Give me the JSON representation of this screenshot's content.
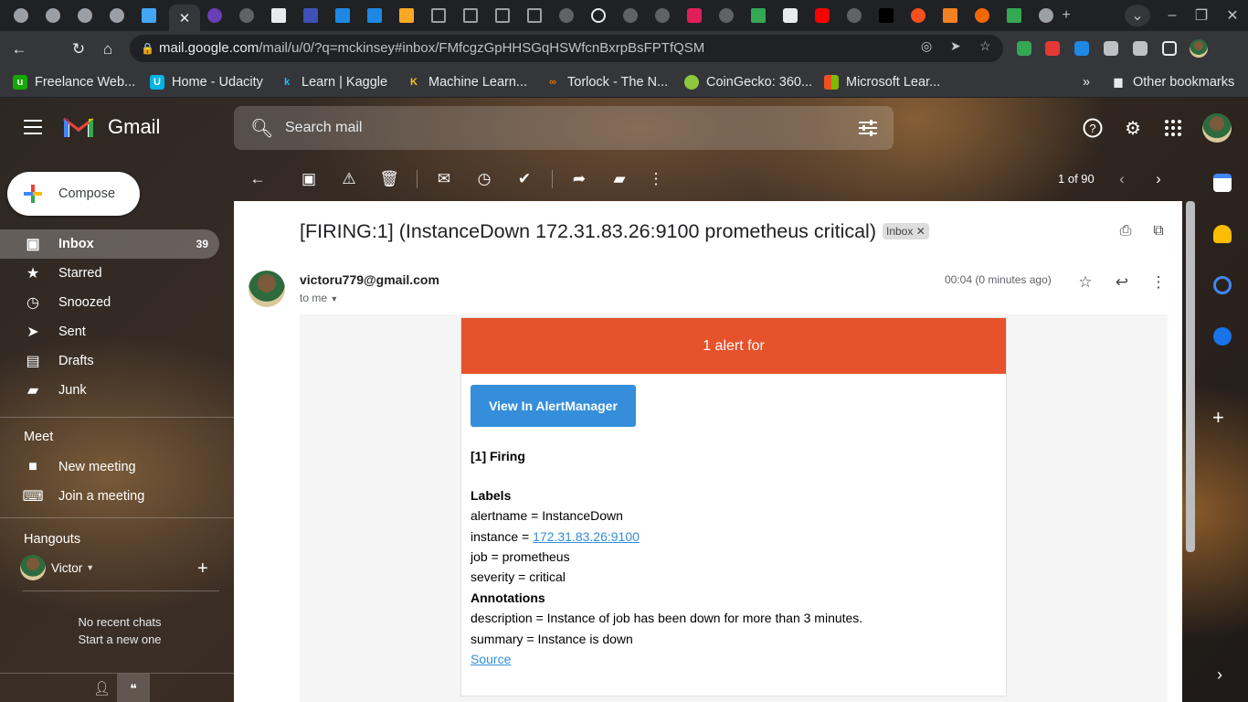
{
  "browser": {
    "address_host": "mail.google.com",
    "address_path": "/mail/u/0/?q=mckinsey#inbox/FMfcgzGpHHSGqHSWfcnBxrpBsFPTfQSM",
    "bookmarks": [
      {
        "label": "Freelance Web...",
        "icon": "upwork-icon",
        "color": "#14a800"
      },
      {
        "label": "Home - Udacity",
        "icon": "udacity-icon",
        "color": "#02b3e4"
      },
      {
        "label": "Learn | Kaggle",
        "icon": "kaggle-icon",
        "color": "#20beff"
      },
      {
        "label": "Machine Learn...",
        "icon": "k-icon",
        "color": "#f5c518"
      },
      {
        "label": "Torlock - The N...",
        "icon": "torlock-icon",
        "color": "#e8710a"
      },
      {
        "label": "CoinGecko: 360...",
        "icon": "coingecko-icon",
        "color": "#8dc63f"
      },
      {
        "label": "Microsoft Lear...",
        "icon": "microsoft-icon",
        "color": "#f25022"
      }
    ],
    "other_bookmarks": "Other bookmarks"
  },
  "gmail": {
    "brand": "Gmail",
    "search_placeholder": "Search mail",
    "compose": "Compose",
    "nav": [
      {
        "label": "Inbox",
        "count": "39",
        "icon": "inbox-icon",
        "active": true
      },
      {
        "label": "Starred",
        "count": "",
        "icon": "star-icon"
      },
      {
        "label": "Snoozed",
        "count": "",
        "icon": "clock-icon"
      },
      {
        "label": "Sent",
        "count": "",
        "icon": "send-icon"
      },
      {
        "label": "Drafts",
        "count": "",
        "icon": "draft-icon"
      },
      {
        "label": "Junk",
        "count": "",
        "icon": "label-icon"
      }
    ],
    "meet": {
      "heading": "Meet",
      "new_meeting": "New meeting",
      "join_meeting": "Join a meeting"
    },
    "hangouts": {
      "heading": "Hangouts",
      "user": "Victor",
      "no_chats": "No recent chats",
      "start_new": "Start a new one"
    },
    "pager": "1 of 90"
  },
  "message": {
    "subject": "[FIRING:1] (InstanceDown 172.31.83.26:9100 prometheus critical)",
    "badge": "Inbox",
    "sender": "victoru779@gmail.com",
    "to": "to me",
    "time": "00:04 (0 minutes ago)",
    "alert": {
      "header": "1 alert for",
      "button": "View In AlertManager",
      "firing": "[1] Firing",
      "labels_heading": "Labels",
      "alertname": "alertname = InstanceDown",
      "instance_prefix": "instance = ",
      "instance_link": "172.31.83.26:9100",
      "job": "job = prometheus",
      "severity": "severity = critical",
      "annotations_heading": "Annotations",
      "description": "description = Instance of job has been down for more than 3 minutes.",
      "summary": "summary = Instance is down",
      "source": "Source",
      "header_color": "#e6522c",
      "button_color": "#348eda"
    }
  }
}
